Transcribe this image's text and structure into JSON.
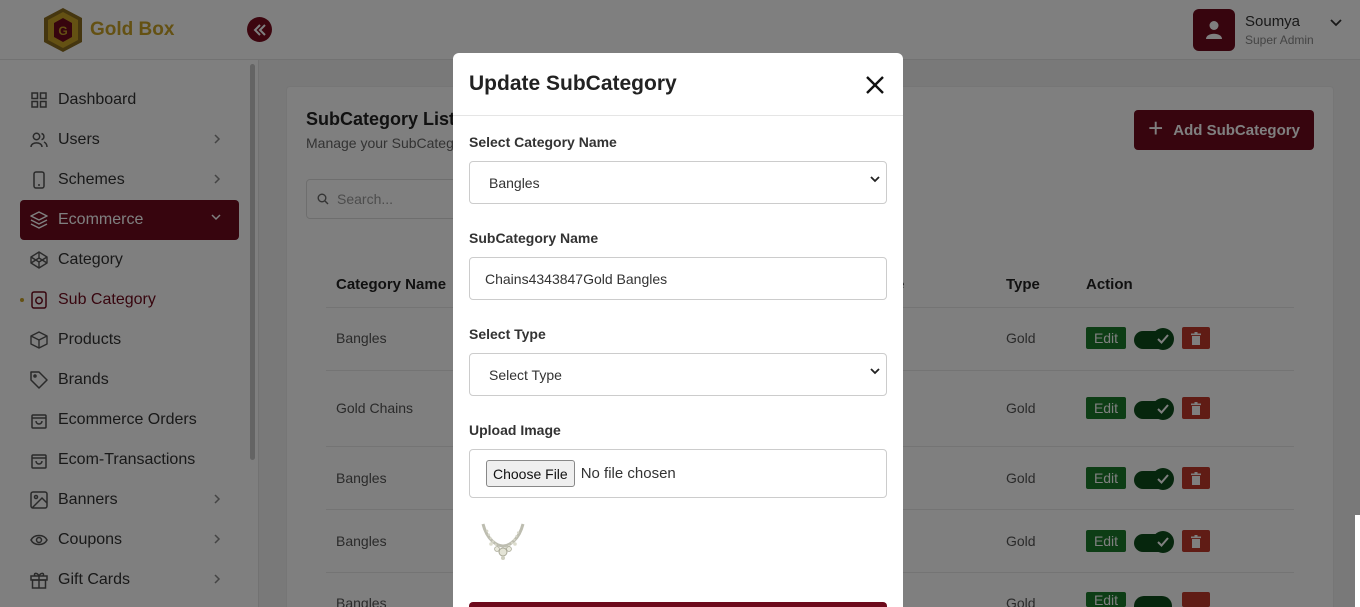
{
  "header": {
    "brand": "Gold Box",
    "user": {
      "name": "Soumya",
      "role": "Super Admin"
    }
  },
  "sidebar": {
    "items": [
      {
        "label": "Dashboard",
        "icon": "grid-icon",
        "chevron": false
      },
      {
        "label": "Users",
        "icon": "users-icon",
        "chevron": true
      },
      {
        "label": "Schemes",
        "icon": "phone-icon",
        "chevron": true
      },
      {
        "label": "Ecommerce",
        "icon": "layers-icon",
        "chevron": true,
        "active": true
      },
      {
        "label": "Category",
        "icon": "codepen-icon",
        "chevron": false
      },
      {
        "label": "Sub Category",
        "icon": "camera-box-icon",
        "chevron": false,
        "current": true
      },
      {
        "label": "Products",
        "icon": "box-icon",
        "chevron": false
      },
      {
        "label": "Brands",
        "icon": "tag-icon",
        "chevron": false
      },
      {
        "label": "Ecommerce Orders",
        "icon": "shopping-bag-icon",
        "chevron": false
      },
      {
        "label": "Ecom-Transactions",
        "icon": "shopping-bag-icon",
        "chevron": false
      },
      {
        "label": "Banners",
        "icon": "image-icon",
        "chevron": true
      },
      {
        "label": "Coupons",
        "icon": "eye-icon",
        "chevron": true
      },
      {
        "label": "Gift Cards",
        "icon": "gift-icon",
        "chevron": true
      }
    ]
  },
  "page": {
    "title": "SubCategory List",
    "subtitle": "Manage your SubCateg",
    "add_button": "Add SubCategory",
    "search_placeholder": "Search..."
  },
  "table": {
    "columns": {
      "category": "Category Name",
      "type": "Type",
      "action": "Action",
      "partial": "e"
    },
    "rows": [
      {
        "category": "Bangles",
        "type": "Gold"
      },
      {
        "category": "Gold Chains",
        "type": "Gold"
      },
      {
        "category": "Bangles",
        "type": "Gold"
      },
      {
        "category": "Bangles",
        "type": "Gold"
      },
      {
        "category": "Bangles",
        "type": "Gold"
      }
    ],
    "edit_label": "Edit"
  },
  "modal": {
    "title": "Update SubCategory",
    "category_label": "Select Category Name",
    "category_value": "Bangles",
    "name_label": "SubCategory Name",
    "name_value": "Chains4343847Gold Bangles",
    "type_label": "Select Type",
    "type_value": "Select Type",
    "image_label": "Upload Image",
    "file_button": "Choose File",
    "file_status": "No file chosen"
  },
  "colors": {
    "primary": "#6e0a1c",
    "gold": "#c9a227",
    "edit": "#1a7a2a",
    "delete": "#c0392b"
  }
}
